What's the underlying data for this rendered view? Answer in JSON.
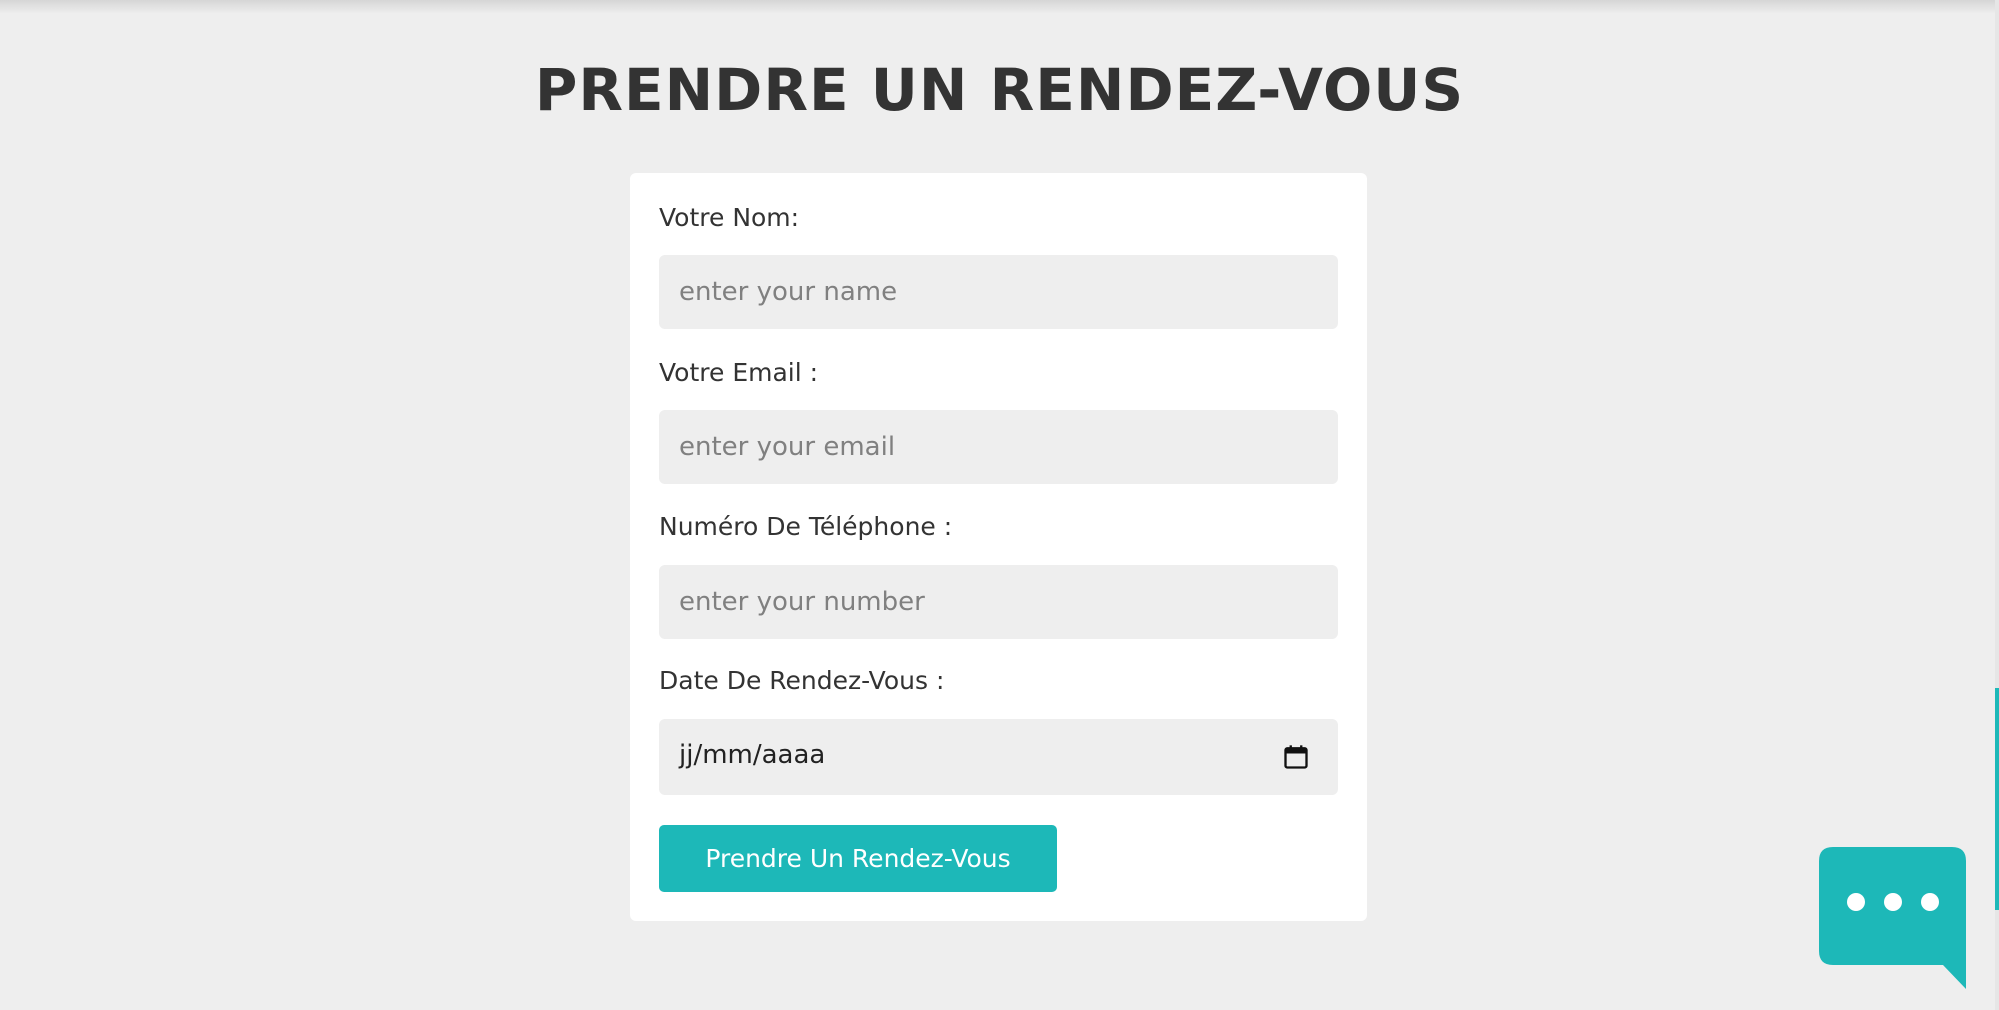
{
  "page": {
    "heading": "PRENDRE UN RENDEZ-VOUS"
  },
  "form": {
    "name": {
      "label": "Votre Nom:",
      "placeholder": "enter your name"
    },
    "email": {
      "label": "Votre Email :",
      "placeholder": "enter your email"
    },
    "phone": {
      "label": "Numéro De Téléphone :",
      "placeholder": "enter your number"
    },
    "date": {
      "label": "Date De Rendez-Vous :",
      "value": "jj/mm/aaaa",
      "icon": "calendar-icon"
    },
    "submit_label": "Prendre Un Rendez-Vous"
  },
  "chat_widget": {
    "icon": "chat-bubble-icon"
  },
  "colors": {
    "accent": "#1db8b8",
    "background": "#eeeeee",
    "card": "#ffffff",
    "heading_text": "#333333",
    "placeholder_text": "#808080"
  }
}
